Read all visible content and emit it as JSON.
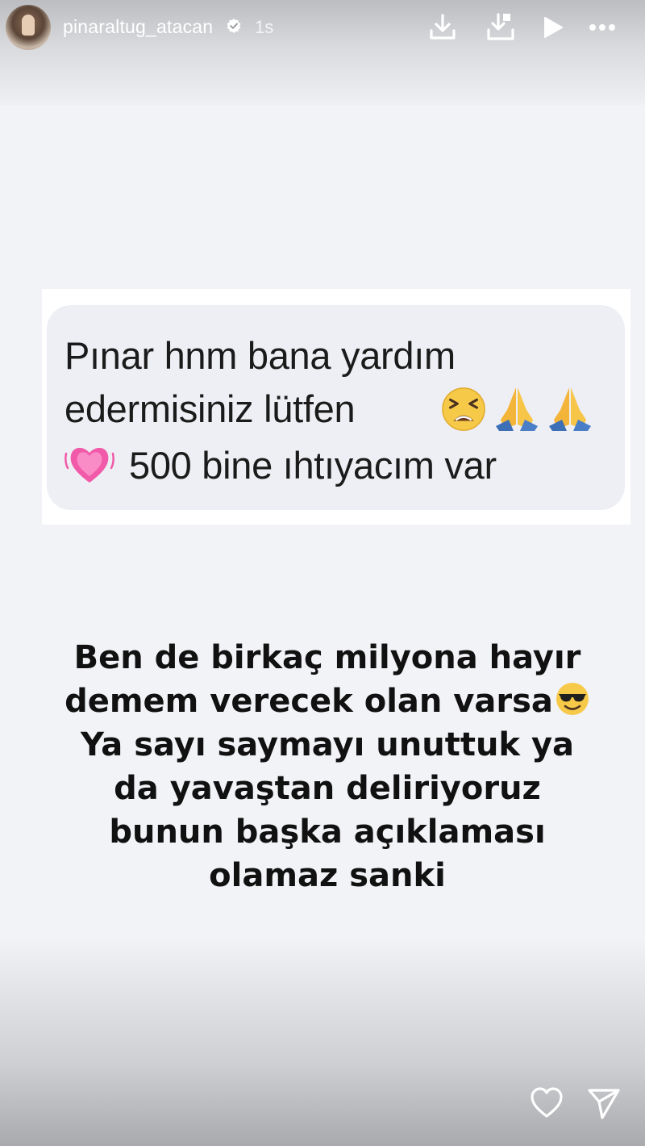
{
  "header": {
    "username": "pinaraltug_atacan",
    "time": "1s",
    "icons": [
      "verified-badge-icon",
      "download-icon",
      "saved-icon",
      "play-icon",
      "more-icon"
    ]
  },
  "dm_message": {
    "line1": "Pınar hnm bana yardım",
    "line2": "edermisiniz lütfen",
    "line3": "500 bine ıhtıyacım var",
    "emojis": [
      "weary-face-emoji",
      "folded-hands-emoji",
      "folded-hands-emoji",
      "growing-heart-emoji"
    ]
  },
  "caption": {
    "lines": [
      "Ben de birkaç milyona hayır",
      "demem verecek olan varsa",
      "Ya sayı saymayı unuttuk ya",
      "da yavaştan deliriyoruz",
      "bunun başka açıklaması",
      "olamaz sanki"
    ],
    "emoji": "sunglasses-face-emoji"
  },
  "footer": {
    "icons": [
      "heart-icon",
      "send-icon"
    ]
  },
  "colors": {
    "story_background": "#f2f3f7",
    "bubble": "#eeeff4",
    "text": "#111111",
    "header_text": "#ffffff"
  }
}
